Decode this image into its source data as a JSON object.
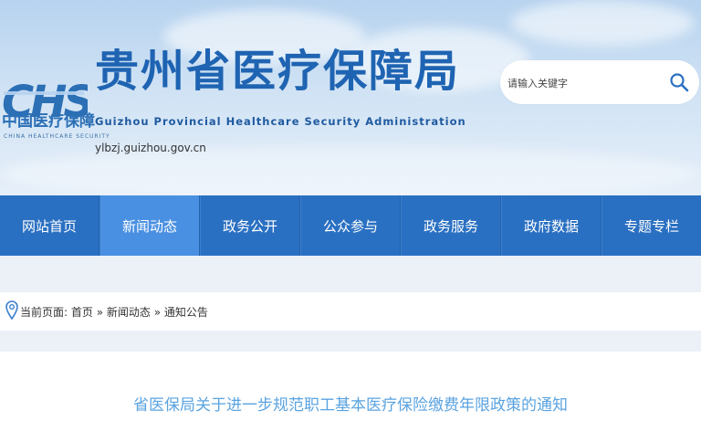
{
  "header": {
    "logo_mark": "CHS",
    "logo_cn": "中国医疗保障",
    "logo_en": "CHINA HEALTHCARE SECURITY",
    "site_title": "贵州省医疗保障局",
    "site_title_en": "Guizhou Provincial Healthcare Security Administration",
    "site_url": "ylbzj.guizhou.gov.cn",
    "search": {
      "placeholder": "请输入关键字",
      "icon": "search-icon"
    }
  },
  "nav": {
    "items": [
      {
        "label": "网站首页",
        "active": false
      },
      {
        "label": "新闻动态",
        "active": true
      },
      {
        "label": "政务公开",
        "active": false
      },
      {
        "label": "公众参与",
        "active": false
      },
      {
        "label": "政务服务",
        "active": false
      },
      {
        "label": "政府数据",
        "active": false
      },
      {
        "label": "专题专栏",
        "active": false
      }
    ]
  },
  "breadcrumb": {
    "prefix": "当前页面:",
    "items": [
      "首页",
      "新闻动态",
      "通知公告"
    ],
    "separator": "»",
    "icon": "location-pin-icon"
  },
  "article": {
    "title": "省医保局关于进一步规范职工基本医疗保险缴费年限政策的通知"
  },
  "colors": {
    "brand_blue": "#1f64b2",
    "nav_bg": "#2a70c2",
    "nav_active": "#4a90e2",
    "title_blue": "#5aa3e0"
  }
}
